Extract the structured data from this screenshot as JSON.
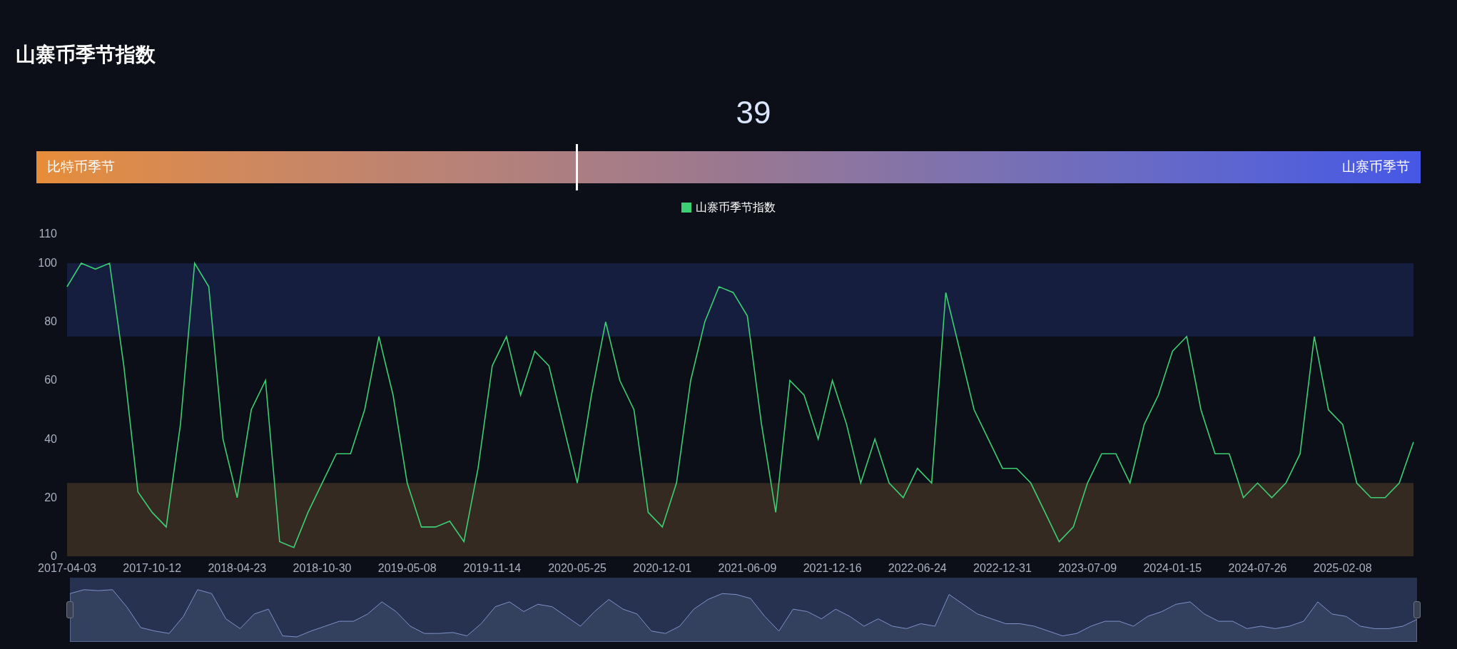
{
  "title": "山寨币季节指数",
  "index": {
    "value": "39",
    "level": 0.39,
    "left_label": "比特币季节",
    "right_label": "山寨币季节"
  },
  "chart": {
    "chart_data": {
      "type": "line",
      "ylim": [
        0,
        110
      ],
      "yticks": [
        0,
        20,
        40,
        60,
        80,
        100,
        110
      ],
      "categories": [
        "2017-04-03",
        null,
        null,
        null,
        null,
        null,
        "2017-10-12",
        null,
        null,
        null,
        null,
        null,
        "2018-04-23",
        null,
        null,
        null,
        null,
        null,
        "2018-10-30",
        null,
        null,
        null,
        null,
        null,
        "2019-05-08",
        null,
        null,
        null,
        null,
        null,
        "2019-11-14",
        null,
        null,
        null,
        null,
        null,
        "2020-05-25",
        null,
        null,
        null,
        null,
        null,
        "2020-12-01",
        null,
        null,
        null,
        null,
        null,
        "2021-06-09",
        null,
        null,
        null,
        null,
        null,
        "2021-12-16",
        null,
        null,
        null,
        null,
        null,
        "2022-06-24",
        null,
        null,
        null,
        null,
        null,
        "2022-12-31",
        null,
        null,
        null,
        null,
        null,
        "2023-07-09",
        null,
        null,
        null,
        null,
        null,
        "2024-01-15",
        null,
        null,
        null,
        null,
        null,
        "2024-07-26",
        null,
        null,
        null,
        null,
        null,
        "2025-02-08",
        null,
        null,
        null,
        null,
        null
      ],
      "series": [
        {
          "name": "山寨币季节指数",
          "color": "#3ccf73",
          "values": [
            92,
            100,
            98,
            100,
            65,
            22,
            15,
            10,
            45,
            100,
            92,
            40,
            20,
            50,
            60,
            5,
            3,
            15,
            25,
            35,
            35,
            50,
            75,
            55,
            25,
            10,
            10,
            12,
            5,
            30,
            65,
            75,
            55,
            70,
            65,
            45,
            25,
            55,
            80,
            60,
            50,
            15,
            10,
            25,
            60,
            80,
            92,
            90,
            82,
            45,
            15,
            60,
            55,
            40,
            60,
            45,
            25,
            40,
            25,
            20,
            30,
            25,
            90,
            70,
            50,
            40,
            30,
            30,
            25,
            15,
            5,
            10,
            25,
            35,
            35,
            25,
            45,
            55,
            70,
            75,
            50,
            35,
            35,
            20,
            25,
            20,
            25,
            35,
            75,
            50,
            45,
            25,
            20,
            20,
            25,
            39
          ]
        }
      ]
    }
  }
}
